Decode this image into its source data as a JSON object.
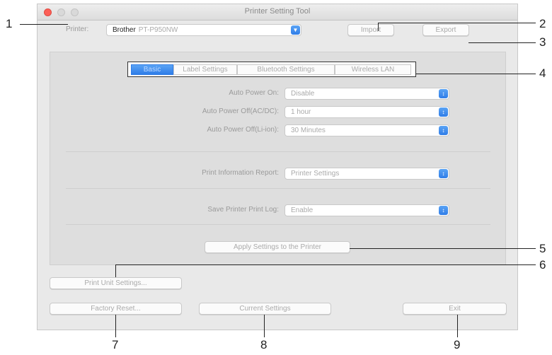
{
  "window": {
    "title": "Printer Setting Tool"
  },
  "printer": {
    "label": "Printer:",
    "brand": "Brother",
    "model": "PT-P950NW"
  },
  "toolbar": {
    "import_label": "Import",
    "export_label": "Export"
  },
  "tabs": [
    {
      "label": "Basic",
      "active": true
    },
    {
      "label": "Label Settings",
      "active": false
    },
    {
      "label": "Bluetooth Settings",
      "active": false
    },
    {
      "label": "Wireless LAN",
      "active": false
    }
  ],
  "settings": {
    "auto_power_on": {
      "label": "Auto Power On:",
      "value": "Disable"
    },
    "auto_power_off_ac": {
      "label": "Auto Power Off(AC/DC):",
      "value": "1 hour"
    },
    "auto_power_off_li": {
      "label": "Auto Power Off(Li-ion):",
      "value": "30 Minutes"
    },
    "print_info_report": {
      "label": "Print Information Report:",
      "value": "Printer Settings"
    },
    "save_print_log": {
      "label": "Save Printer Print Log:",
      "value": "Enable"
    }
  },
  "actions": {
    "apply_label": "Apply Settings to the Printer",
    "print_unit_label": "Print Unit Settings...",
    "factory_reset_label": "Factory Reset...",
    "current_settings_label": "Current Settings",
    "exit_label": "Exit"
  },
  "callouts": [
    "1",
    "2",
    "3",
    "4",
    "5",
    "6",
    "7",
    "8",
    "9"
  ],
  "colors": {
    "accent": "#2f7de8",
    "close": "#fc5f57"
  },
  "icons": {
    "select_arrow": "chevron-updown-icon",
    "printer_arrow": "chevron-down-icon"
  }
}
